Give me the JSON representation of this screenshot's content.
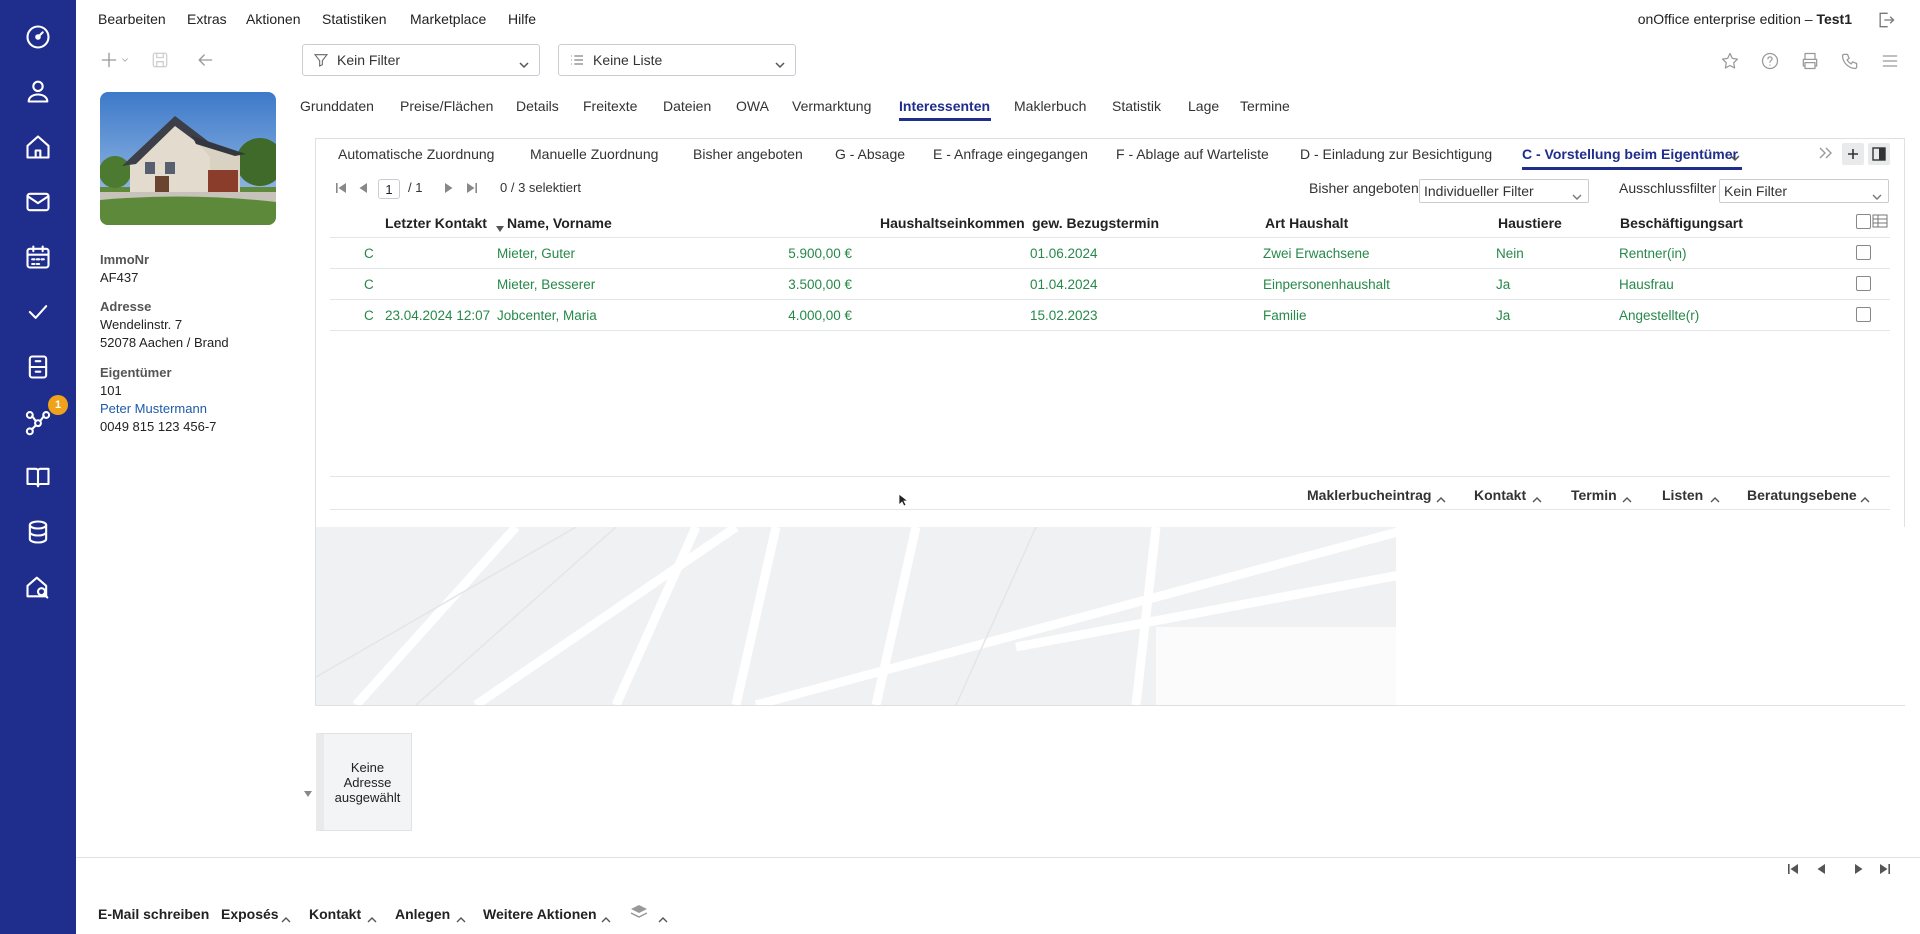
{
  "menu": [
    "Bearbeiten",
    "Extras",
    "Aktionen",
    "Statistiken",
    "Marketplace",
    "Hilfe"
  ],
  "edition": {
    "label": "onOffice enterprise edition",
    "separator": "–",
    "user": "Test1"
  },
  "toolbar": {
    "filter_value": "Kein Filter",
    "list_value": "Keine Liste"
  },
  "property": {
    "immonr_label": "ImmoNr",
    "immonr": "AF437",
    "address_label": "Adresse",
    "street": "Wendelinstr. 7",
    "city": "52078 Aachen / Brand",
    "owner_label": "Eigentümer",
    "owner_id": "101",
    "owner_name": "Peter Mustermann",
    "owner_phone": "0049 815 123 456-7"
  },
  "main_tabs": [
    "Grunddaten",
    "Preise/Flächen",
    "Details",
    "Freitexte",
    "Dateien",
    "OWA",
    "Vermarktung",
    "Interessenten",
    "Maklerbuch",
    "Statistik",
    "Lage",
    "Termine"
  ],
  "active_main_tab": "Interessenten",
  "sub_tabs": [
    "Automatische Zuordnung",
    "Manuelle Zuordnung",
    "Bisher angeboten",
    "G - Absage",
    "E - Anfrage eingegangen",
    "F - Ablage auf Warteliste",
    "D - Einladung zur Besichtigung",
    "C - Vorstellung beim Eigentümer"
  ],
  "pager": {
    "page": "1",
    "total": "/ 1",
    "selected": "0 / 3 selektiert"
  },
  "filters": {
    "bisher_label": "Bisher angeboten",
    "bisher_value": "Individueller Filter",
    "ausschluss_label": "Ausschlussfilter",
    "ausschluss_value": "Kein Filter"
  },
  "table": {
    "headers": [
      "Letzter Kontakt",
      "Name, Vorname",
      "Haushaltseinkommen",
      "gew. Bezugstermin",
      "Art Haushalt",
      "Haustiere",
      "Beschäftigungsart"
    ],
    "rows": [
      {
        "status": "C",
        "kontakt": "",
        "name": "Mieter, Guter",
        "einkommen": "5.900,00 €",
        "termin": "01.06.2024",
        "haushalt": "Zwei Erwachsene",
        "haustiere": "Nein",
        "beschaeftigung": "Rentner(in)"
      },
      {
        "status": "C",
        "kontakt": "",
        "name": "Mieter, Besserer",
        "einkommen": "3.500,00 €",
        "termin": "01.04.2024",
        "haushalt": "Einpersonenhaushalt",
        "haustiere": "Ja",
        "beschaeftigung": "Hausfrau"
      },
      {
        "status": "C",
        "kontakt": "23.04.2024 12:07",
        "name": "Jobcenter, Maria",
        "einkommen": "4.000,00 €",
        "termin": "15.02.2023",
        "haushalt": "Familie",
        "haustiere": "Ja",
        "beschaeftigung": "Angestellte(r)"
      }
    ]
  },
  "table_actions": [
    "Maklerbucheintrag",
    "Kontakt",
    "Termin",
    "Listen",
    "Beratungsebene"
  ],
  "no_address": "Keine Adresse ausgewählt",
  "bottom_actions": [
    "E-Mail schreiben",
    "Exposés",
    "Kontakt",
    "Anlegen",
    "Weitere Aktionen"
  ],
  "nav_badge": "1",
  "colors": {
    "nav": "#1f2d8c",
    "accent": "#1f2d8c",
    "row_text": "#27884a",
    "badge": "#f0a21a"
  }
}
